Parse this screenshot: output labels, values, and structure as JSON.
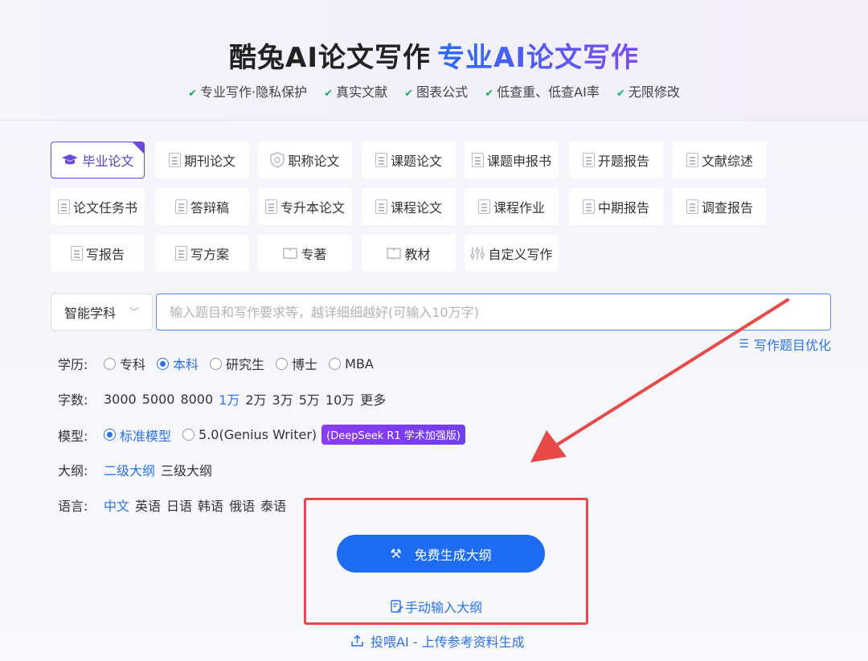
{
  "header": {
    "title_main": "酷兔AI论文写作",
    "title_accent": "专业AI论文写作",
    "features": [
      "专业写作·隐私保护",
      "真实文献",
      "图表公式",
      "低查重、低查AI率",
      "无限修改"
    ]
  },
  "tiles": [
    {
      "label": "毕业论文",
      "icon": "graduation-cap-icon",
      "active": true
    },
    {
      "label": "期刊论文",
      "icon": "journal-icon"
    },
    {
      "label": "职称论文",
      "icon": "badge-shield-icon"
    },
    {
      "label": "课题论文",
      "icon": "bookmark-doc-icon"
    },
    {
      "label": "课题申报书",
      "icon": "document-icon"
    },
    {
      "label": "开题报告",
      "icon": "report-icon"
    },
    {
      "label": "文献综述",
      "icon": "document-icon"
    },
    {
      "label": "论文任务书",
      "icon": "document-icon"
    },
    {
      "label": "答辩稿",
      "icon": "checklist-icon"
    },
    {
      "label": "专升本论文",
      "icon": "document-search-icon"
    },
    {
      "label": "课程论文",
      "icon": "document-icon"
    },
    {
      "label": "课程作业",
      "icon": "document-search-icon"
    },
    {
      "label": "中期报告",
      "icon": "document-icon"
    },
    {
      "label": "调查报告",
      "icon": "report-icon"
    },
    {
      "label": "写报告",
      "icon": "document-search-icon"
    },
    {
      "label": "写方案",
      "icon": "edit-doc-icon"
    },
    {
      "label": "专著",
      "icon": "book-icon"
    },
    {
      "label": "教材",
      "icon": "book-icon"
    },
    {
      "label": "自定义写作",
      "icon": "sliders-icon"
    }
  ],
  "subject": {
    "label": "智能学科"
  },
  "topic": {
    "placeholder": "输入题目和写作要求等，越详细细越好(可输入10万字)"
  },
  "optimize": {
    "label": "写作题目优化"
  },
  "education": {
    "label": "学历:",
    "options": [
      "专科",
      "本科",
      "研究生",
      "博士",
      "MBA"
    ],
    "selected": "本科"
  },
  "wordcount": {
    "label": "字数:",
    "options": [
      "3000",
      "5000",
      "8000",
      "1万",
      "2万",
      "3万",
      "5万",
      "10万",
      "更多"
    ],
    "selected": "1万"
  },
  "model": {
    "label": "模型:",
    "options": [
      "标准模型",
      "5.0(Genius Writer)"
    ],
    "selected": "标准模型",
    "badge": "(DeepSeek R1 学术加强版)"
  },
  "outline": {
    "label": "大纲:",
    "options": [
      "二级大纲",
      "三级大纲"
    ],
    "selected": "二级大纲"
  },
  "language": {
    "label": "语言:",
    "options": [
      "中文",
      "英语",
      "日语",
      "韩语",
      "俄语",
      "泰语"
    ],
    "selected": "中文"
  },
  "actions": {
    "generate": "免费生成大纲",
    "manual": "手动输入大纲",
    "upload": "投喂AI - 上传参考资料生成"
  },
  "colors": {
    "accent_blue": "#1e6cf2",
    "accent_purple": "#6a4ad8",
    "annotation_red": "#e84a4a",
    "check_green": "#16b15a"
  }
}
